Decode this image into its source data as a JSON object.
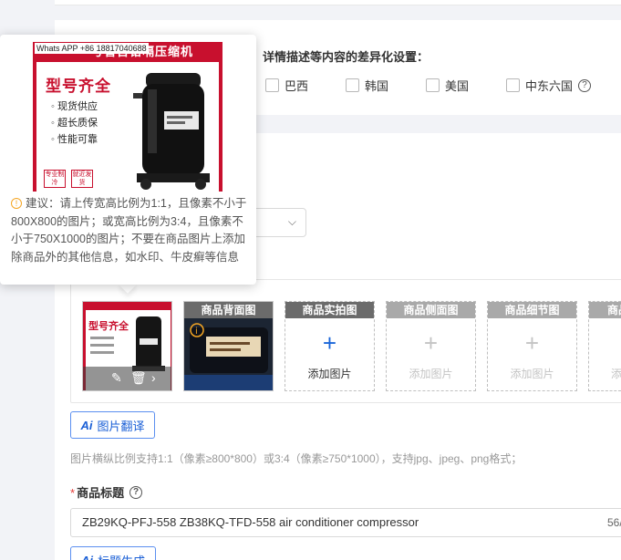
{
  "diff_settings": {
    "label": "详情描述等内容的差异化设置：",
    "countries": [
      "巴西",
      "韩国",
      "美国",
      "中东六国"
    ]
  },
  "popover": {
    "preview_banner": "号管百铬嗝压缩机",
    "whatsapp": "Whats APP +86 18817040688",
    "model_title": "型号齐全",
    "features": [
      "现货供应",
      "超长质保",
      "性能可靠"
    ],
    "stamps": [
      "专业制冷",
      "就近发货"
    ],
    "suggestion": "建议：请上传宽高比例为1:1，且像素不小于800X800的图片；或宽高比例为3:4，且像素不小于750X1000的图片；不要在商品图片上添加除商品外的其他信息，如水印、牛皮癣等信息"
  },
  "image_slots": {
    "slot2_header": "商品背面图",
    "add_slots": [
      {
        "header": "商品实拍图",
        "add_label": "添加图片",
        "enabled": true
      },
      {
        "header": "商品侧面图",
        "add_label": "添加图片",
        "enabled": false
      },
      {
        "header": "商品细节图",
        "add_label": "添加图片",
        "enabled": false
      },
      {
        "header": "商品",
        "add_label": "添",
        "enabled": false
      }
    ]
  },
  "translate_button": {
    "ai": "Ai",
    "label": "图片翻译"
  },
  "format_hint": "图片横纵比例支持1:1（像素≥800*800）或3:4（像素≥750*1000），支持jpg、jpeg、png格式；",
  "title_field": {
    "required_mark": "*",
    "label": "商品标题",
    "value": "ZB29KQ-PFJ-558 ZB38KQ-TFD-558 air conditioner compressor",
    "counter": "56/"
  },
  "generate_button": {
    "ai": "Ai",
    "label": "标题生成"
  },
  "colors": {
    "accent": "#1a5fd6",
    "brand_red": "#c8102e",
    "warn": "#f5a623"
  }
}
